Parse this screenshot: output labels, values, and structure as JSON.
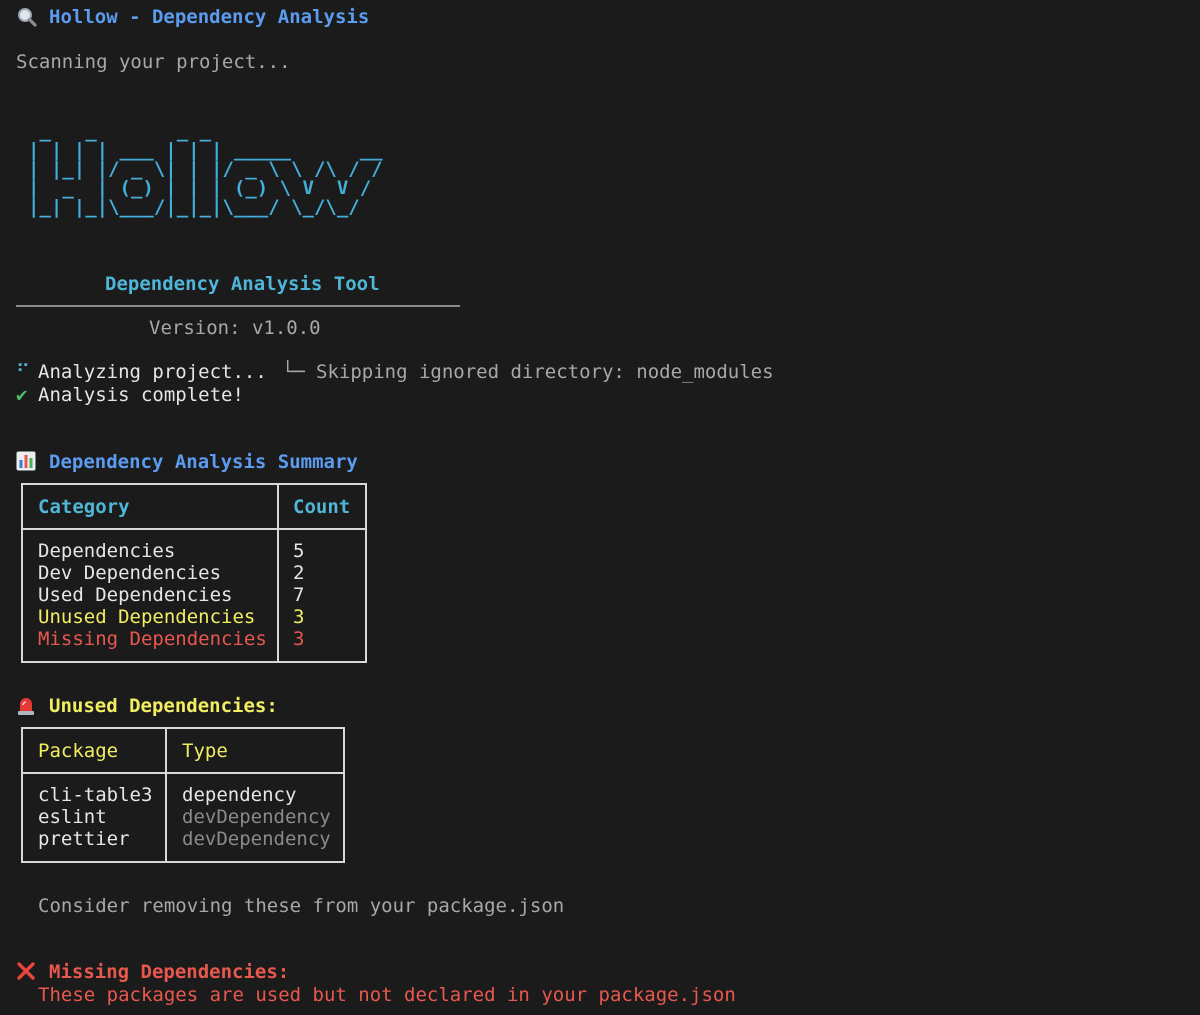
{
  "header": {
    "icon": "magnifier-icon",
    "title": "Hollow - Dependency Analysis"
  },
  "scanning_text": "Scanning your project...",
  "banner": {
    "logo_ascii": " _   _       _ _\n| | | | ___ | | | _____      __\n| |_| |/ _ \\| | |/ _ \\ \\ /\\ / /\n|  _  | (_) | | | (_) \\ V  V /\n|_| |_|\\___/|_|_|\\___/ \\_/\\_/",
    "tool_name": "Dependency Analysis Tool",
    "version": "Version: v1.0.0"
  },
  "progress": {
    "spinner_glyph": "⠋",
    "analyzing_text": "Analyzing project...",
    "skip_branch_glyph": "└─",
    "skip_text": "Skipping ignored directory: node_modules",
    "check_glyph": "✔",
    "complete_text": "Analysis complete!"
  },
  "summary": {
    "icon": "bar-chart-icon",
    "title": "Dependency Analysis Summary",
    "headers": [
      "Category",
      "Count"
    ],
    "rows": [
      {
        "category": "Dependencies",
        "count": "5",
        "status": "normal"
      },
      {
        "category": "Dev Dependencies",
        "count": "2",
        "status": "normal"
      },
      {
        "category": "Used Dependencies",
        "count": "7",
        "status": "normal"
      },
      {
        "category": "Unused Dependencies",
        "count": "3",
        "status": "warning"
      },
      {
        "category": "Missing Dependencies",
        "count": "3",
        "status": "error"
      }
    ]
  },
  "unused": {
    "icon": "siren-icon",
    "title": "Unused Dependencies:",
    "headers": [
      "Package",
      "Type"
    ],
    "rows": [
      {
        "package": "cli-table3",
        "type": "dependency"
      },
      {
        "package": "eslint",
        "type": "devDependency"
      },
      {
        "package": "prettier",
        "type": "devDependency"
      }
    ],
    "hint": "Consider removing these from your package.json"
  },
  "missing": {
    "icon": "cross-mark-icon",
    "title": "Missing Dependencies:",
    "description": "These packages are used but not declared in your package.json"
  },
  "colors": {
    "background": "#1b1b1b",
    "title_blue": "#5b9cf0",
    "header_cyan": "#4fb6d8",
    "warning_yellow": "#f2ee62",
    "error_red": "#e8584e",
    "success_green": "#4fbf6a"
  }
}
